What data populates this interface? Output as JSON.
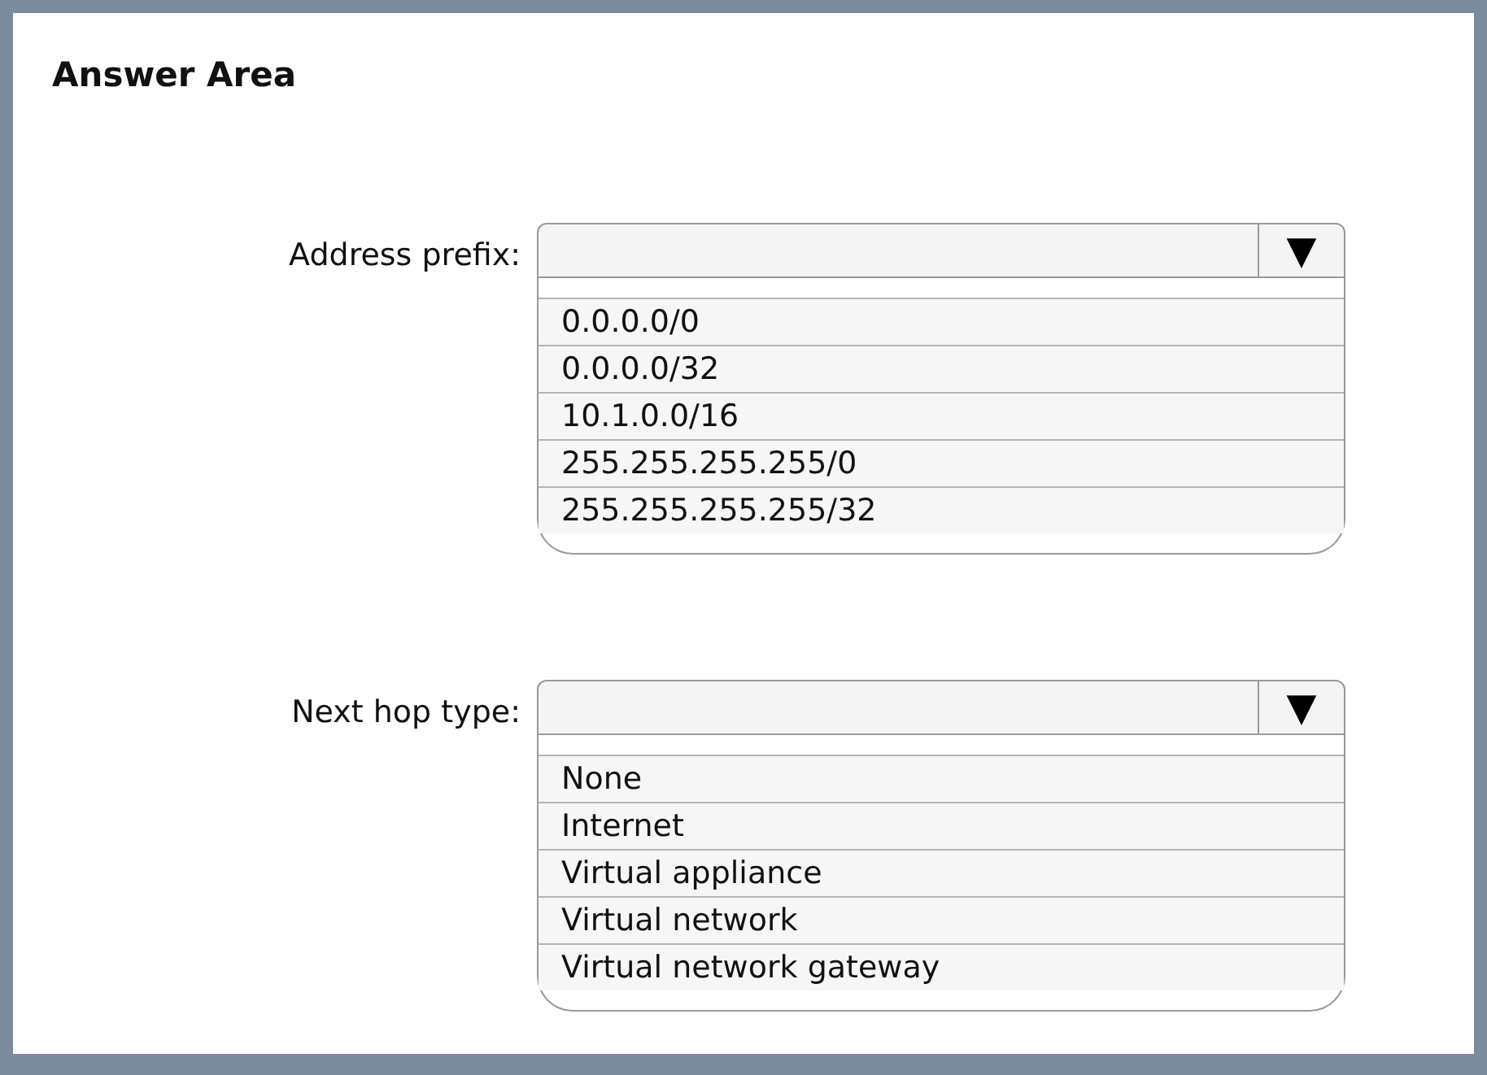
{
  "title": "Answer Area",
  "dropdowns": [
    {
      "label": "Address prefix:",
      "arrow": "▼",
      "options": [
        "0.0.0.0/0",
        "0.0.0.0/32",
        "10.1.0.0/16",
        "255.255.255.255/0",
        "255.255.255.255/32"
      ]
    },
    {
      "label": "Next hop type:",
      "arrow": "▼",
      "options": [
        "None",
        "Internet",
        "Virtual appliance",
        "Virtual network",
        "Virtual network gateway"
      ]
    }
  ]
}
